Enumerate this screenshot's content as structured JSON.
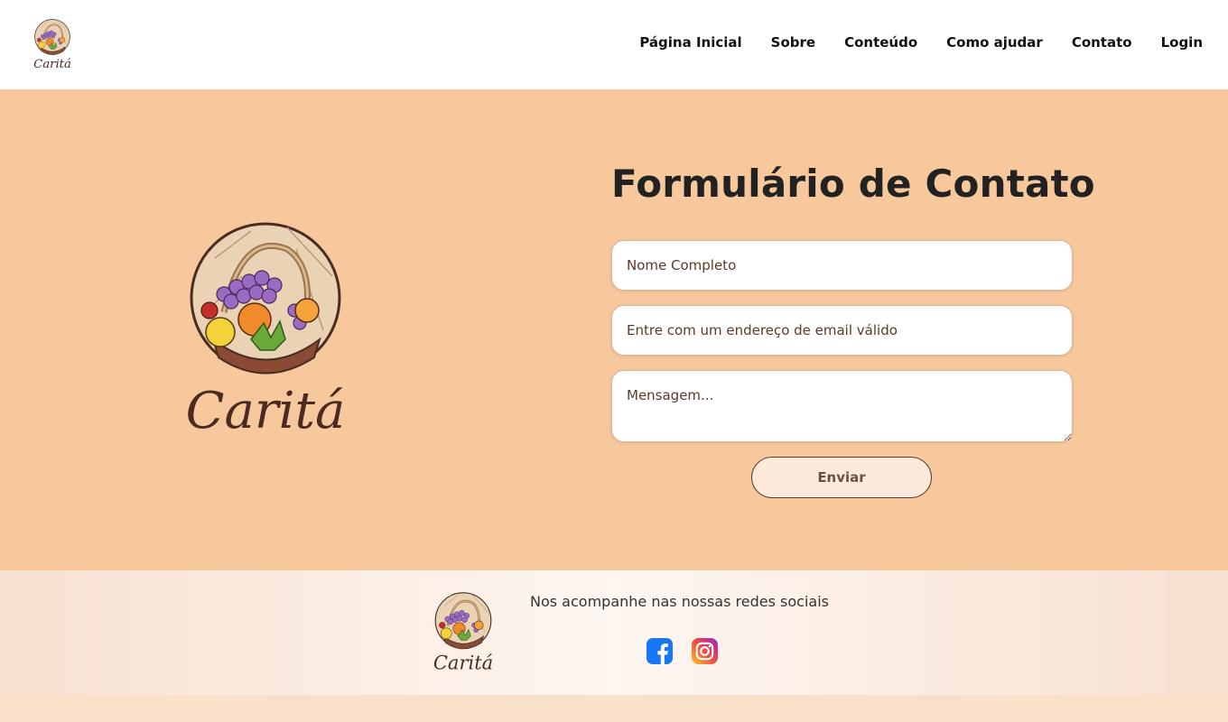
{
  "brand": {
    "name": "Caritá"
  },
  "nav": {
    "items": [
      {
        "label": "Página Inicial"
      },
      {
        "label": "Sobre"
      },
      {
        "label": "Conteúdo"
      },
      {
        "label": "Como ajudar"
      },
      {
        "label": "Contato"
      },
      {
        "label": "Login"
      }
    ]
  },
  "contact_form": {
    "title": "Formulário de Contato",
    "name_placeholder": "Nome Completo",
    "email_placeholder": "Entre com um endereço de email válido",
    "message_placeholder": "Mensagem...",
    "submit_label": "Enviar"
  },
  "footer": {
    "social_text": "Nos acompanhe nas nossas redes sociais",
    "social_icons": [
      "facebook-icon",
      "instagram-icon"
    ]
  },
  "colors": {
    "hero_bg": "#f7c89c",
    "header_bg": "#ffffff",
    "button_bg": "#fdeadb",
    "brand_brown": "#5a3a2a"
  }
}
